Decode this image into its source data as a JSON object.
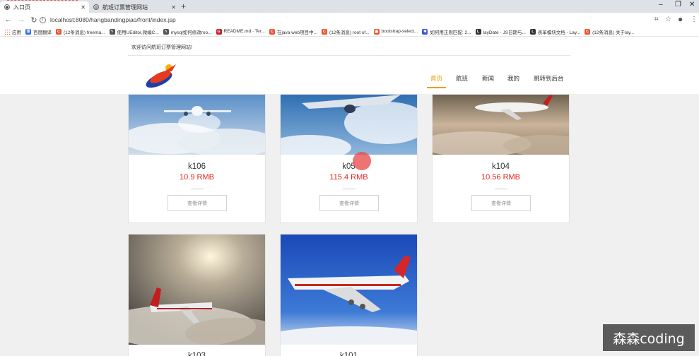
{
  "browser": {
    "tabs": [
      {
        "title": "入口页"
      },
      {
        "title": "航班订票管理网站"
      }
    ],
    "url": "localhost:8080/hangbandingpiao/front/index.jsp",
    "apps_label": "应用",
    "bookmarks": [
      {
        "label": "百度翻译",
        "color": "#2b6de8",
        "glyph": "译"
      },
      {
        "label": "(12条消息) freema...",
        "color": "#e8532d",
        "glyph": "C"
      },
      {
        "label": "使用UEditor,微编C...",
        "color": "#555555",
        "glyph": "ϟ"
      },
      {
        "label": "mysql如何修改roo...",
        "color": "#555555",
        "glyph": "ϟ"
      },
      {
        "label": "README.md · Ter...",
        "color": "#c71d23",
        "glyph": "G"
      },
      {
        "label": "在java web项目中...",
        "color": "#e8532d",
        "glyph": "C"
      },
      {
        "label": "(12条消息) root of...",
        "color": "#e8532d",
        "glyph": "C"
      },
      {
        "label": "bootstrap-select...",
        "color": "#e8532d",
        "glyph": "▣"
      },
      {
        "label": "如何用正则匹配: 2...",
        "color": "#3a55c9",
        "glyph": "✱"
      },
      {
        "label": "layDate - JS日期与...",
        "color": "#333333",
        "glyph": "L"
      },
      {
        "label": "表单模块文档 - Lay...",
        "color": "#333333",
        "glyph": "L"
      },
      {
        "label": "(12条消息) 关于lay...",
        "color": "#e8532d",
        "glyph": "C"
      }
    ]
  },
  "header": {
    "welcome": "欢迎访问航班订票管理网站!",
    "nav": [
      "首页",
      "航班",
      "新闻",
      "我的",
      "跳转到后台"
    ]
  },
  "flights": [
    {
      "name": "k106",
      "price": "10.9 RMB",
      "button": "查看详情"
    },
    {
      "name": "k05",
      "price": "115.4 RMB",
      "button": "查看详情"
    },
    {
      "name": "k104",
      "price": "10.56 RMB",
      "button": "查看详情"
    },
    {
      "name": "k103",
      "price": "",
      "button": ""
    },
    {
      "name": "k101",
      "price": "",
      "button": ""
    }
  ],
  "watermark": "森森coding",
  "colors": {
    "accent": "#e8a000",
    "price": "#e0261e"
  }
}
